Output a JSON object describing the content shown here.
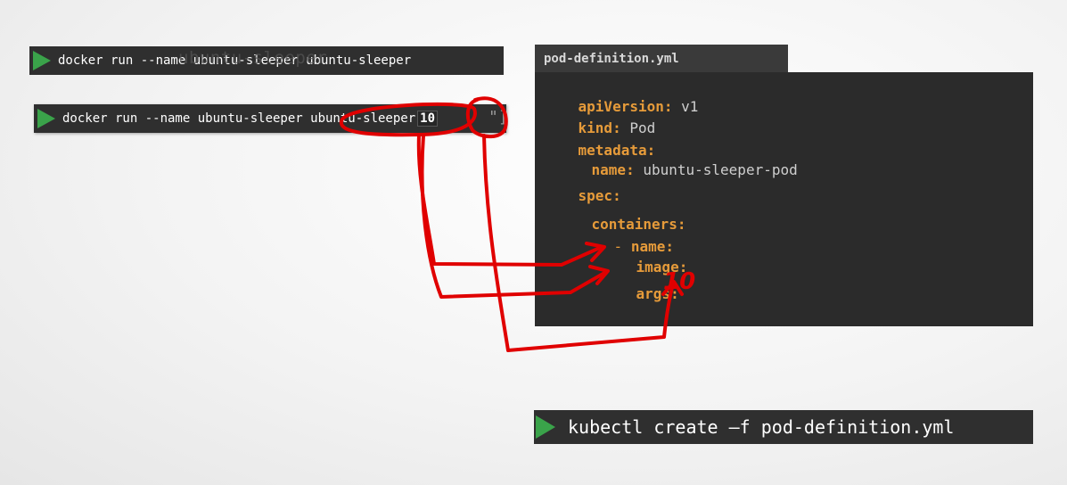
{
  "terminal1": {
    "command": "docker run --name ubuntu-sleeper ubuntu-sleeper",
    "ghost_text": "ubuntu-sleeper"
  },
  "terminal2": {
    "command_prefix": "docker run --name ubuntu-sleeper ubuntu-sleeper",
    "arg": "10",
    "ghost_suffix": "\"]"
  },
  "file_tab": {
    "title": "pod-definition.yml"
  },
  "yaml": {
    "api_key": "apiVersion:",
    "api_val": "v1",
    "kind_key": "kind:",
    "kind_val": "Pod",
    "metadata_key": "metadata:",
    "name_key": "name:",
    "name_val": "ubuntu-sleeper-pod",
    "spec_key": "spec:",
    "containers_key": "containers:",
    "dash": "-",
    "cname_key": "name:",
    "image_key": "image:",
    "args_key": "args:",
    "args_val": "10"
  },
  "terminal3": {
    "command": "kubectl create –f pod-definition.yml"
  },
  "colors": {
    "annotation": "#e00000",
    "prompt": "#3aa34a",
    "yaml_key": "#e69b3a"
  }
}
